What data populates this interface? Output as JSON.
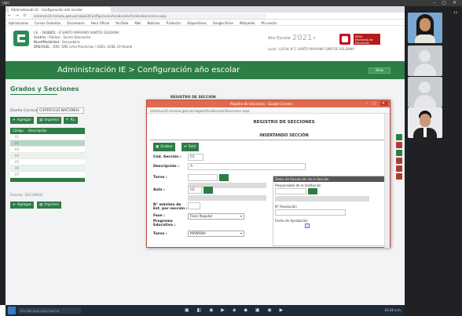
{
  "meet": {
    "top_label": "ugc",
    "controls": "– ▢ ✕",
    "side_label": "‹‹"
  },
  "browser": {
    "tab_title": "Administración IE - Configuración año escolar",
    "url": "sistemas10.minedu.gob.pe/siagie3/ConfiguracionAnioEscolar/GradosSecciones.aspx",
    "bookmarks": [
      "Aplicaciones",
      "Cursos Gratuitos",
      "Diccionario",
      "Hora Oficial",
      "YouTube",
      "Mail",
      "Noticias",
      "Traductor",
      "Diapositivas",
      "Google Drive",
      "Wikipedia",
      "Mi cuenta"
    ]
  },
  "header": {
    "inst_lines": [
      {
        "k": "I.E. - 1640851 - 0",
        "v": "SANTO MARIANO SANTOS SOLDANA"
      },
      {
        "k": "Gestión :",
        "v": "Pública - Sector Educación"
      },
      {
        "k": "Nivel/Modalidad :",
        "v": "Secundaria"
      },
      {
        "k": "DRE/UGEL :",
        "v": "DRE: DRE Lima Provincias / UGEL: UGEL 10 Huaral"
      }
    ],
    "periodo_label": "Año Escolar",
    "periodo_year": "2021",
    "local_label": "Local :",
    "local_value": "LOCAL N°1 SANTO MARIANO SANTOS SOLDANA",
    "ministry_line1": "PERÚ",
    "ministry_line2": "Ministerio de Educación"
  },
  "banner": {
    "title": "Administración IE > Configuración año escolar",
    "back_label": "Atrás"
  },
  "content": {
    "section_title": "Grados y Secciones",
    "disenio_label": "Diseño Curricular :",
    "disenio_value": "CURRICULO NACIONAL",
    "btn_agregar": "Agregar",
    "btn_imprimir": "Imprimir",
    "btn_ruta": "Ru",
    "grid_headers": [
      "Código",
      "Descripción"
    ],
    "grid_rows": [
      "01",
      "02",
      "03",
      "04",
      "05",
      "06",
      "07"
    ],
    "disenio2_label": "Diseño: SEGUNDO",
    "btn_agregar2": "Agregar",
    "btn_imprimir2": "Imprimir"
  },
  "popup": {
    "title": "Registro de Secciones - Google Chrome",
    "addr": "sistemas10.minedu.gob.pe/siagie3/AnioEscolar/Secciones.aspx",
    "heading_top": "REGISTRO DE SECCION",
    "heading": "REGISTRO DE SECCIONES",
    "subheading": "INSERTANDO SECCIÓN",
    "btn_grabar": "Grabar",
    "btn_salir": "Salir",
    "cod_label": "Cód. Sección :",
    "cod_value": "01",
    "desc_label": "Descripción :",
    "desc_value": "A",
    "turno_label": "Turno :",
    "aula_label": "Aula :",
    "aula_value": "02",
    "nro_label": "N° máximo de Est. por sección :",
    "fase_label": "Fase :",
    "fase_value": "Fase Regular",
    "programa_label": "Programa Educativo :",
    "turno2_label": "Turno :",
    "turno2_value": "MAÑANA",
    "res_header": "Datos de Resolución de la Sección",
    "res_resp": "Responsable de la Institución",
    "res_nro": "N° Resolución",
    "res_fecha": "Fecha de Aprobación"
  },
  "taskbar": {
    "search": "Escribe aquí para buscar",
    "apps": "▣ ◧ ◉ ▶ ◈ ◆ ▣ ◉ ▶",
    "clock": "10:24 a.m."
  },
  "colors": {
    "brand_green": "#2d7d46",
    "popup_title": "#e06a4e",
    "meet_bg": "#202124"
  }
}
